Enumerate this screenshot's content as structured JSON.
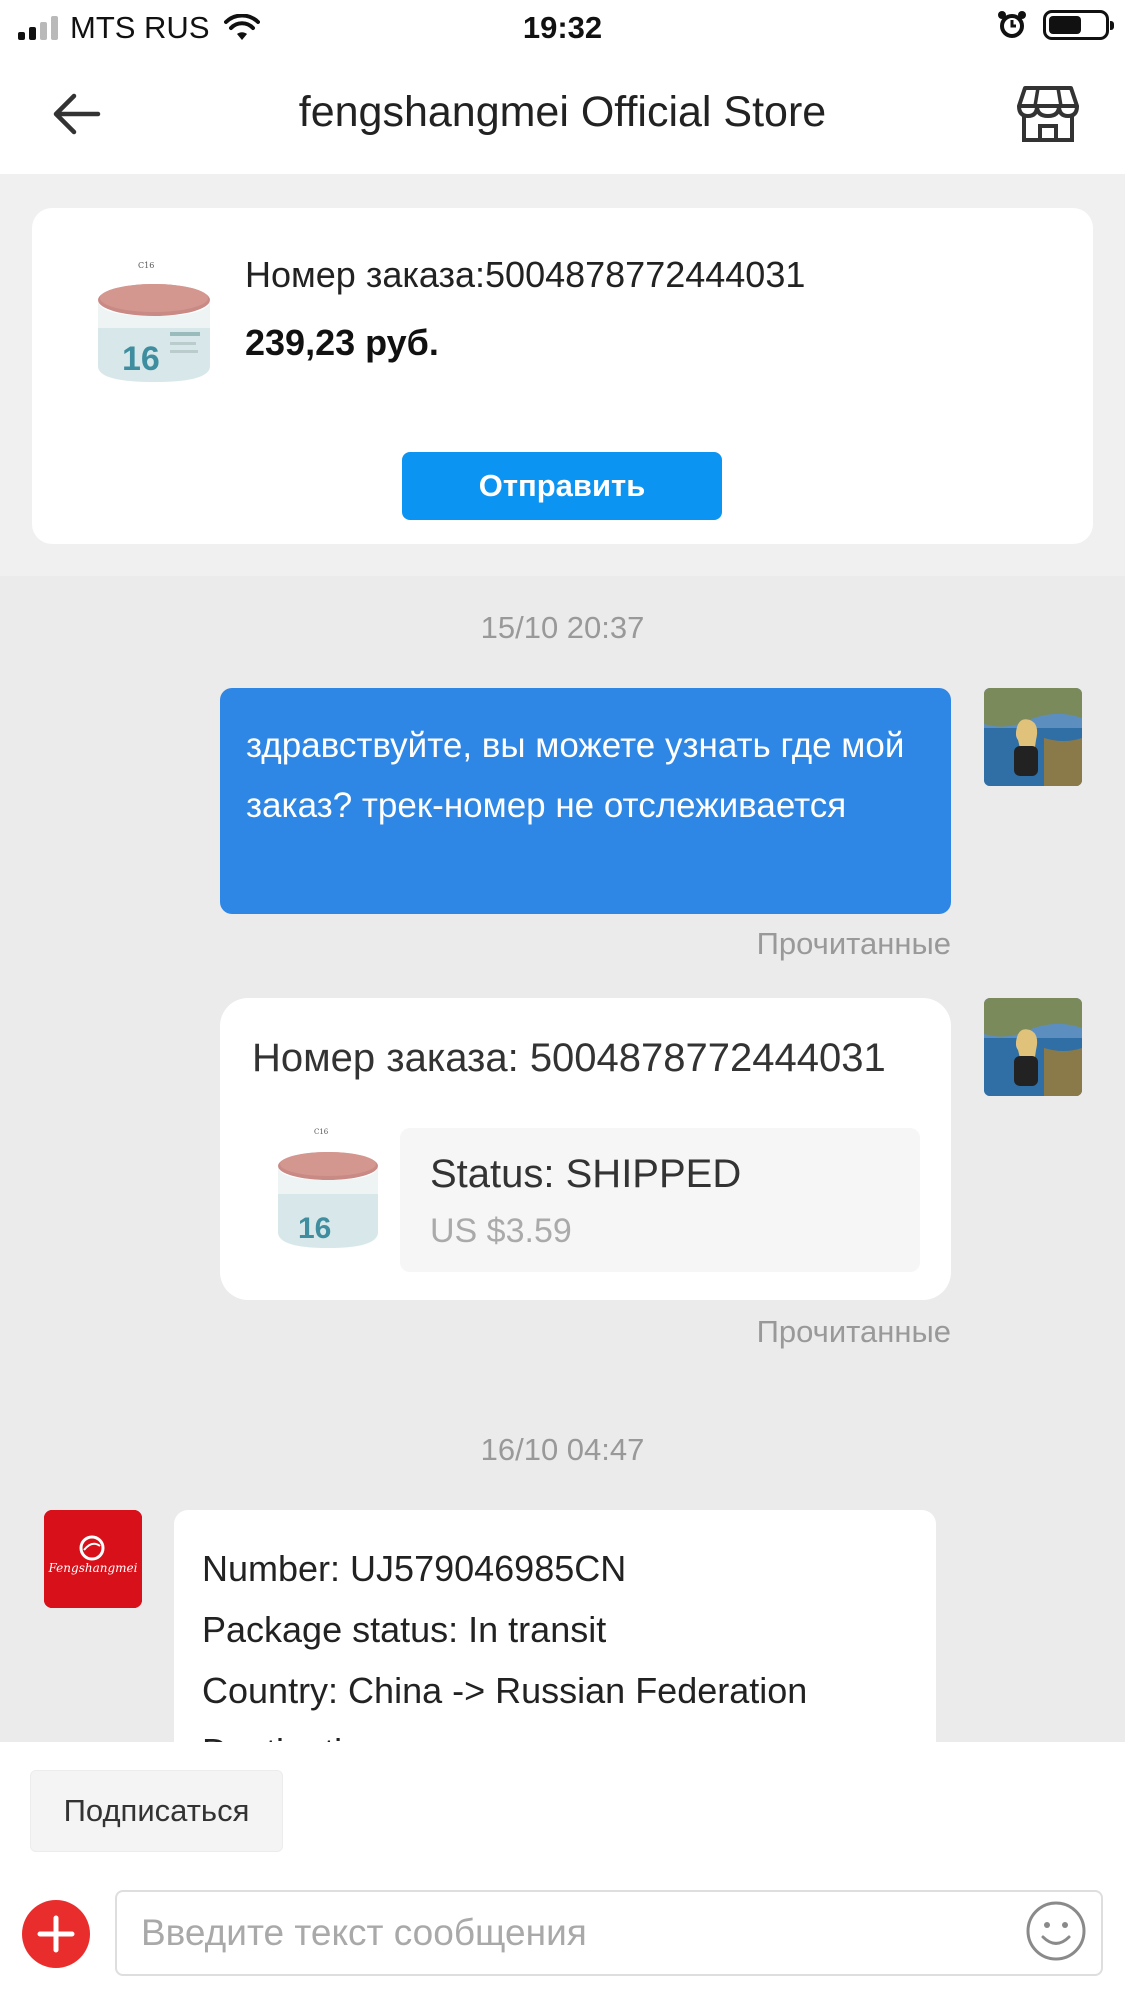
{
  "status_bar": {
    "carrier": "MTS RUS",
    "time": "19:32",
    "battery_level": 0.6
  },
  "nav": {
    "title": "fengshangmei Official Store",
    "icons": {
      "back": "back-arrow-icon",
      "store": "store-icon"
    }
  },
  "order_card": {
    "order_number": "Номер заказа:5004878772444031",
    "price": "239,23 руб.",
    "send_label": "Отправить"
  },
  "chat": {
    "timestamp_1": "15/10 20:37",
    "message_1": "здравствуйте, вы можете узнать где мой заказ? трек-номер не отслеживается",
    "read_1": "Прочитанные",
    "order_message": {
      "title": "Номер заказа: 5004878772444031",
      "status": "Status:  SHIPPED",
      "price": "US $3.59"
    },
    "read_2": "Прочитанные",
    "timestamp_2": "16/10 04:47",
    "store_message": {
      "line1": "Number: UJ579046985CN",
      "line2": "Package status: In transit",
      "line3": "Country: China -> Russian Federation",
      "line4": "Destination:"
    },
    "store_logo_text": "Fengshangmei"
  },
  "bottom": {
    "subscribe_label": "Подписаться",
    "input_placeholder": "Введите текст сообщения",
    "icons": {
      "add": "plus-icon",
      "emoji": "smiley-icon"
    }
  },
  "colors": {
    "accent_blue": "#0c94f2",
    "bubble_blue": "#2e86e5",
    "add_red": "#e92d2d",
    "store_red": "#d8101a"
  }
}
